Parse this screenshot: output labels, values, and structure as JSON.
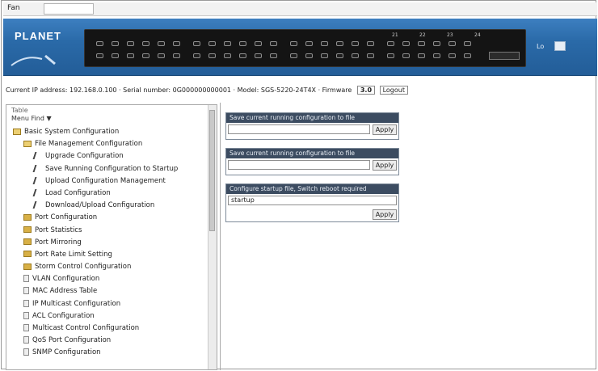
{
  "menubar": {
    "label": "Fan",
    "field_value": ""
  },
  "banner": {
    "brand": "PLANET",
    "ctrl_label": "Lo",
    "panel_tags": [
      "21",
      "22",
      "23",
      "24"
    ]
  },
  "status": {
    "text": "Current IP address: 192.168.0.100 · Serial number: 0G000000000001 · Model: SGS-5220-24T4X · Firmware",
    "version": "3.0",
    "link": "Logout"
  },
  "nav": {
    "top": "Table",
    "search": "Menu   Find ▼",
    "items": [
      {
        "label": "Basic System Configuration",
        "icon": "open-folder-icon",
        "indent": 0
      },
      {
        "label": "File Management Configuration",
        "icon": "open-folder-icon",
        "indent": 1
      },
      {
        "label": "Upgrade Configuration",
        "icon": "tool-icon",
        "indent": 2
      },
      {
        "label": "Save Running Configuration to Startup",
        "icon": "tool-icon",
        "indent": 2
      },
      {
        "label": "Upload Configuration Management",
        "icon": "tool-icon",
        "indent": 2
      },
      {
        "label": "Load Configuration",
        "icon": "tool-icon",
        "indent": 2
      },
      {
        "label": "Download/Upload Configuration",
        "icon": "tool-icon",
        "indent": 2
      },
      {
        "label": "Port Configuration",
        "icon": "folder-icon",
        "indent": 1
      },
      {
        "label": "Port Statistics",
        "icon": "folder-icon",
        "indent": 1
      },
      {
        "label": "Port Mirroring",
        "icon": "folder-icon",
        "indent": 1
      },
      {
        "label": "Port Rate Limit Setting",
        "icon": "folder-icon",
        "indent": 1
      },
      {
        "label": "Storm Control Configuration",
        "icon": "folder-icon",
        "indent": 1
      },
      {
        "label": "VLAN Configuration",
        "icon": "page-icon",
        "indent": 1
      },
      {
        "label": "MAC Address Table",
        "icon": "page-icon",
        "indent": 1
      },
      {
        "label": "IP Multicast Configuration",
        "icon": "page-icon",
        "indent": 1
      },
      {
        "label": "ACL Configuration",
        "icon": "page-icon",
        "indent": 1
      },
      {
        "label": "Multicast Control Configuration",
        "icon": "page-icon",
        "indent": 1
      },
      {
        "label": "QoS Port Configuration",
        "icon": "page-icon",
        "indent": 1
      },
      {
        "label": "SNMP Configuration",
        "icon": "page-icon",
        "indent": 1
      }
    ]
  },
  "content": {
    "box1": {
      "title": "Save current running configuration to file",
      "value": "",
      "button": "Apply"
    },
    "box2": {
      "title": "Save current running configuration to file",
      "value": "",
      "button": "Apply"
    },
    "box3": {
      "title": "Configure startup file, Switch reboot required",
      "value": "startup",
      "button": "Apply"
    }
  }
}
